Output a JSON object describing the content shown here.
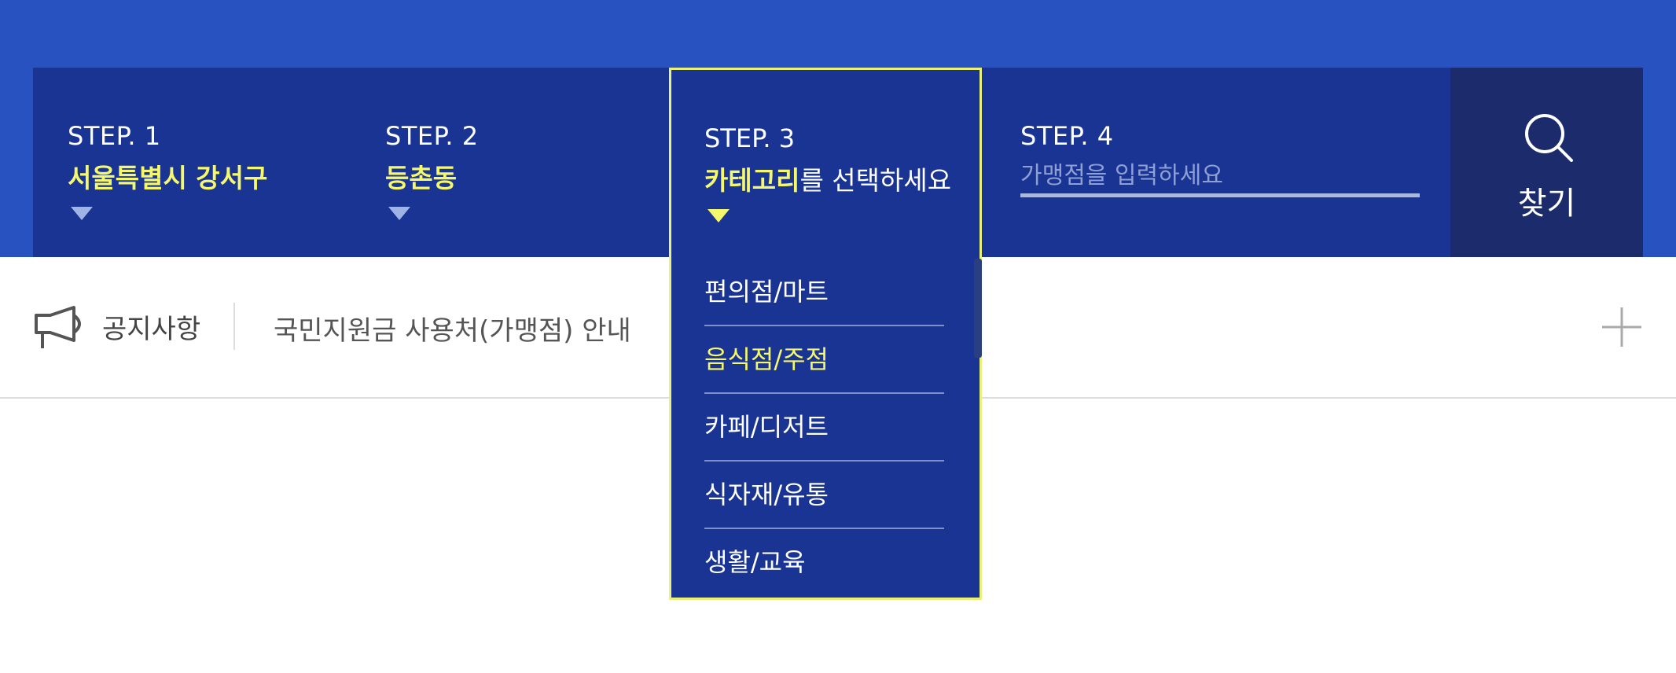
{
  "colors": {
    "band": "#2752bf",
    "bar": "#1a3493",
    "find_button": "#1b2b6b",
    "highlight": "#f5f86a",
    "panel_border": "#e9f277"
  },
  "steps": [
    {
      "title": "STEP. 1",
      "value": "서울특별시 강서구"
    },
    {
      "title": "STEP. 2",
      "value": "등촌동"
    },
    {
      "title": "STEP. 3",
      "value_highlight": "카테고리",
      "value_rest": "를 선택하세요"
    },
    {
      "title": "STEP. 4",
      "placeholder": "가맹점을 입력하세요"
    }
  ],
  "find_button": {
    "label": "찾기",
    "icon": "search-icon"
  },
  "categories": [
    {
      "label": "편의점/마트"
    },
    {
      "label": "음식점/주점"
    },
    {
      "label": "카페/디저트"
    },
    {
      "label": "식자재/유통"
    },
    {
      "label": "생활/교육"
    }
  ],
  "selected_category": "음식점/주점",
  "notice": {
    "icon": "megaphone-icon",
    "label": "공지사항",
    "text": "국민지원금 사용처(가맹점) 안내",
    "more_icon": "plus-icon"
  }
}
